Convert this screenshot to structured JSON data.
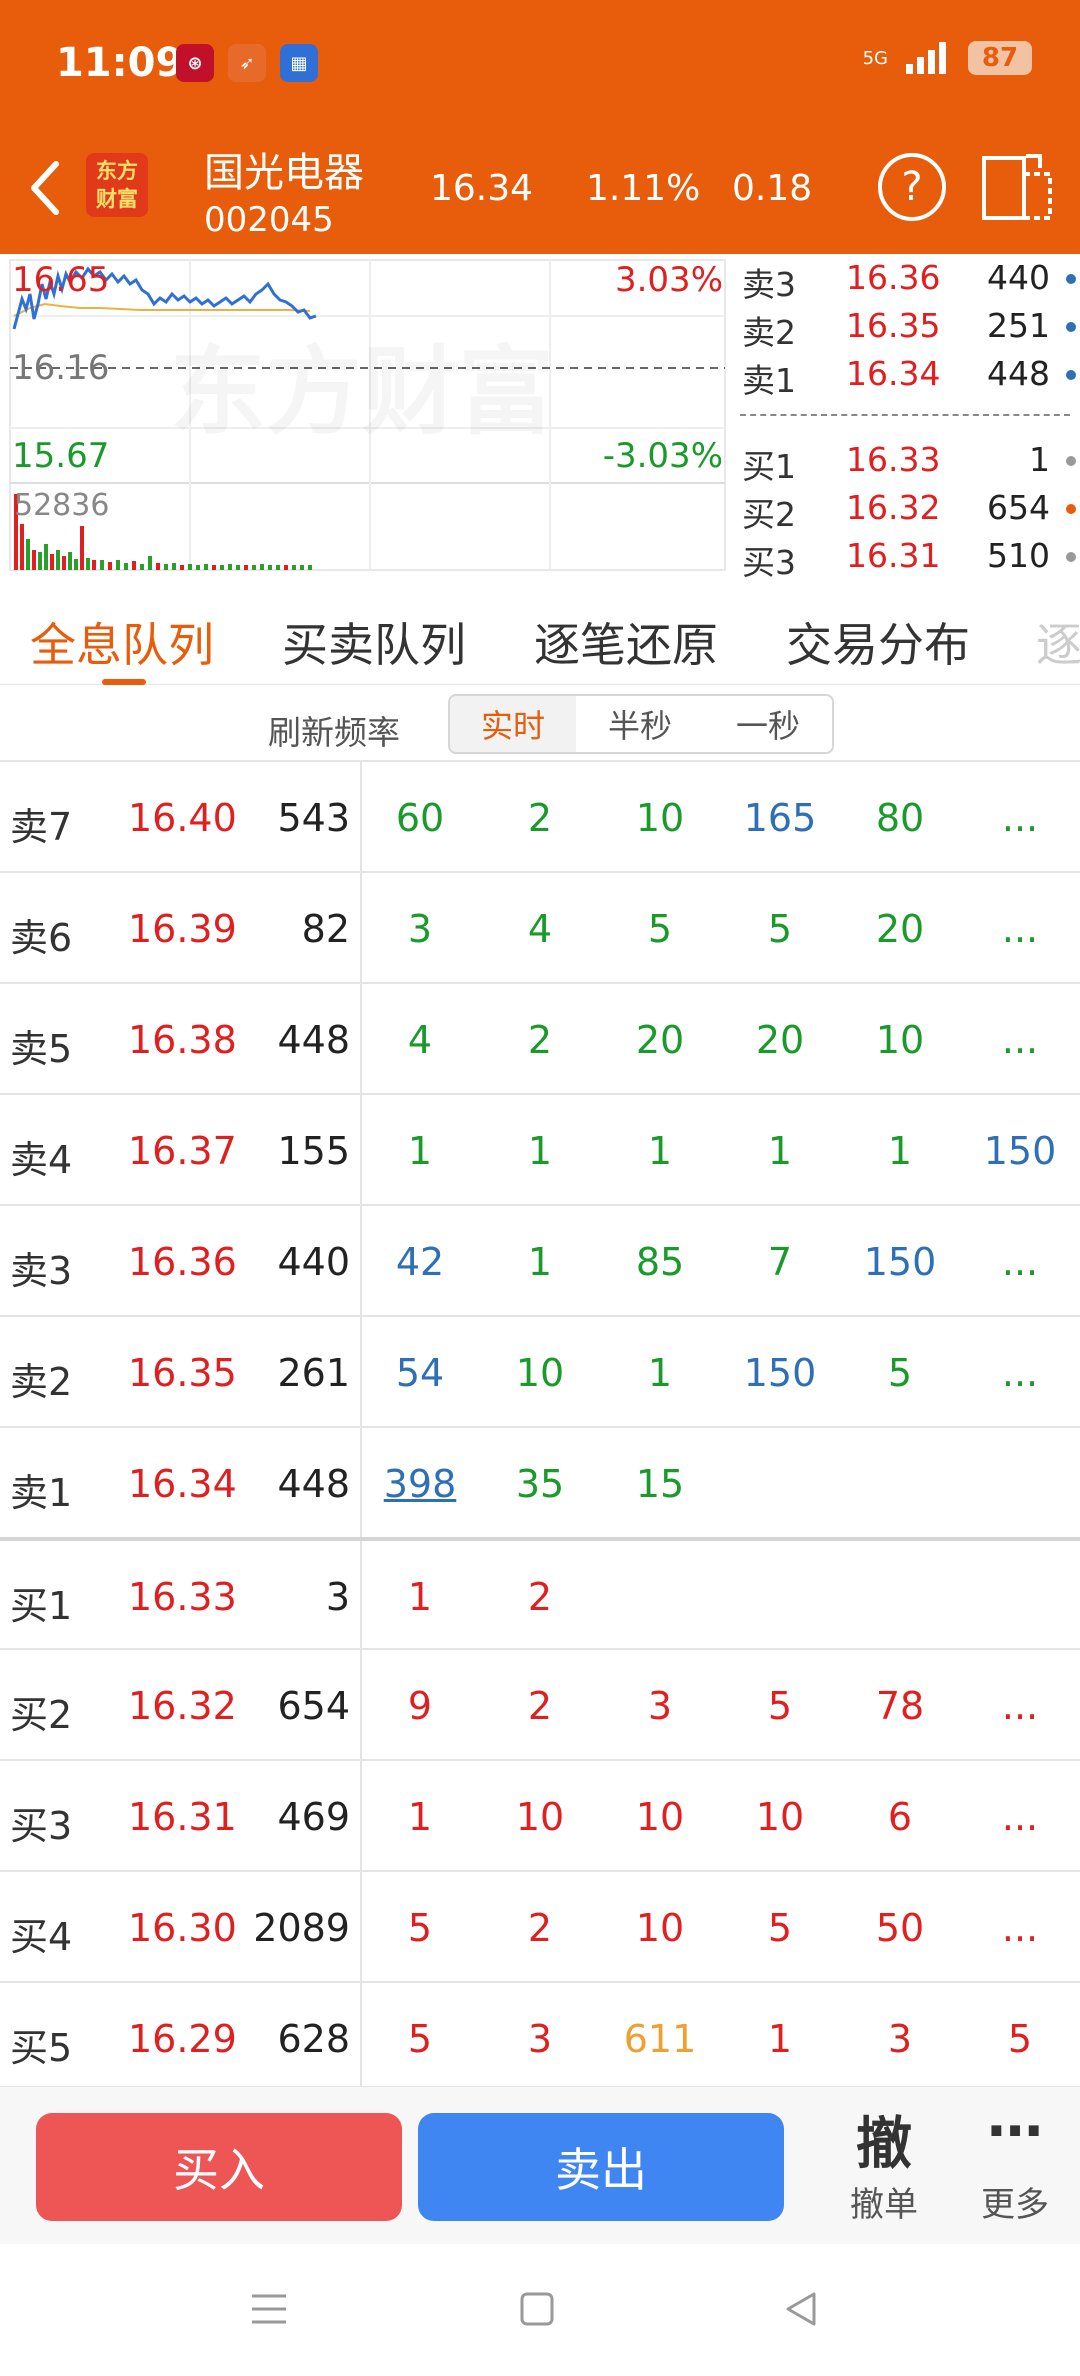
{
  "status": {
    "time": "11:09",
    "signal": "5G",
    "battery": "87"
  },
  "header": {
    "logo_line1": "东方",
    "logo_line2": "财富",
    "stock_name": "国光电器",
    "stock_code": "002045",
    "price": "16.34",
    "change_pct": "1.11%",
    "change": "0.18",
    "help": "?"
  },
  "chart": {
    "high_price": "16.65",
    "high_pct": "3.03%",
    "mid_price": "16.16",
    "low_price": "15.67",
    "low_pct": "-3.03%",
    "volume_max": "52836",
    "watermark": "东方财富"
  },
  "orderbook_mini": [
    {
      "label": "卖3",
      "price": "16.36",
      "volume": "440",
      "dot": "#2f6fb6"
    },
    {
      "label": "卖2",
      "price": "16.35",
      "volume": "251",
      "dot": "#2f6fb6"
    },
    {
      "label": "卖1",
      "price": "16.34",
      "volume": "448",
      "dot": "#2f6fb6"
    },
    {
      "label": "买1",
      "price": "16.33",
      "volume": "1",
      "dot": "#999999"
    },
    {
      "label": "买2",
      "price": "16.32",
      "volume": "654",
      "dot": "#E85D0B"
    },
    {
      "label": "买3",
      "price": "16.31",
      "volume": "510",
      "dot": "#999999"
    }
  ],
  "tabs": [
    "全息队列",
    "买卖队列",
    "逐笔还原",
    "交易分布",
    "逐"
  ],
  "refresh": {
    "label": "刷新频率",
    "options": [
      "实时",
      "半秒",
      "一秒"
    ]
  },
  "queue": [
    {
      "level": "卖7",
      "price": "16.40",
      "qty": "543",
      "cells": [
        [
          "60",
          "green"
        ],
        [
          "2",
          "green"
        ],
        [
          "10",
          "green"
        ],
        [
          "165",
          "blue"
        ],
        [
          "80",
          "green"
        ],
        [
          "...",
          "green"
        ]
      ]
    },
    {
      "level": "卖6",
      "price": "16.39",
      "qty": "82",
      "cells": [
        [
          "3",
          "green"
        ],
        [
          "4",
          "green"
        ],
        [
          "5",
          "green"
        ],
        [
          "5",
          "green"
        ],
        [
          "20",
          "green"
        ],
        [
          "...",
          "green"
        ]
      ]
    },
    {
      "level": "卖5",
      "price": "16.38",
      "qty": "448",
      "cells": [
        [
          "4",
          "green"
        ],
        [
          "2",
          "green"
        ],
        [
          "20",
          "green"
        ],
        [
          "20",
          "green"
        ],
        [
          "10",
          "green"
        ],
        [
          "...",
          "green"
        ]
      ]
    },
    {
      "level": "卖4",
      "price": "16.37",
      "qty": "155",
      "cells": [
        [
          "1",
          "green"
        ],
        [
          "1",
          "green"
        ],
        [
          "1",
          "green"
        ],
        [
          "1",
          "green"
        ],
        [
          "1",
          "green"
        ],
        [
          "150",
          "blue"
        ]
      ]
    },
    {
      "level": "卖3",
      "price": "16.36",
      "qty": "440",
      "cells": [
        [
          "42",
          "blue"
        ],
        [
          "1",
          "green"
        ],
        [
          "85",
          "green"
        ],
        [
          "7",
          "green"
        ],
        [
          "150",
          "blue"
        ],
        [
          "...",
          "green"
        ]
      ]
    },
    {
      "level": "卖2",
      "price": "16.35",
      "qty": "261",
      "cells": [
        [
          "54",
          "blue"
        ],
        [
          "10",
          "green"
        ],
        [
          "1",
          "green"
        ],
        [
          "150",
          "blue"
        ],
        [
          "5",
          "green"
        ],
        [
          "...",
          "green"
        ]
      ]
    },
    {
      "level": "卖1",
      "price": "16.34",
      "qty": "448",
      "cells": [
        [
          "398",
          "blue ul"
        ],
        [
          "35",
          "green"
        ],
        [
          "15",
          "green"
        ]
      ]
    },
    {
      "level": "买1",
      "price": "16.33",
      "qty": "3",
      "cells": [
        [
          "1",
          "red"
        ],
        [
          "2",
          "red"
        ]
      ]
    },
    {
      "level": "买2",
      "price": "16.32",
      "qty": "654",
      "cells": [
        [
          "9",
          "red"
        ],
        [
          "2",
          "red"
        ],
        [
          "3",
          "red"
        ],
        [
          "5",
          "red"
        ],
        [
          "78",
          "red"
        ],
        [
          "...",
          "red"
        ]
      ]
    },
    {
      "level": "买3",
      "price": "16.31",
      "qty": "469",
      "cells": [
        [
          "1",
          "red"
        ],
        [
          "10",
          "red"
        ],
        [
          "10",
          "red"
        ],
        [
          "10",
          "red"
        ],
        [
          "6",
          "red"
        ],
        [
          "...",
          "red"
        ]
      ]
    },
    {
      "level": "买4",
      "price": "16.30",
      "qty": "2089",
      "cells": [
        [
          "5",
          "red"
        ],
        [
          "2",
          "red"
        ],
        [
          "10",
          "red"
        ],
        [
          "5",
          "red"
        ],
        [
          "50",
          "red"
        ],
        [
          "...",
          "red"
        ]
      ]
    },
    {
      "level": "买5",
      "price": "16.29",
      "qty": "628",
      "cells": [
        [
          "5",
          "red"
        ],
        [
          "3",
          "red"
        ],
        [
          "611",
          "orange"
        ],
        [
          "1",
          "red"
        ],
        [
          "3",
          "red"
        ],
        [
          "5",
          "red"
        ]
      ]
    }
  ],
  "actions": {
    "buy": "买入",
    "sell": "卖出",
    "cancel_icon": "撤",
    "cancel": "撤单",
    "more": "更多"
  }
}
